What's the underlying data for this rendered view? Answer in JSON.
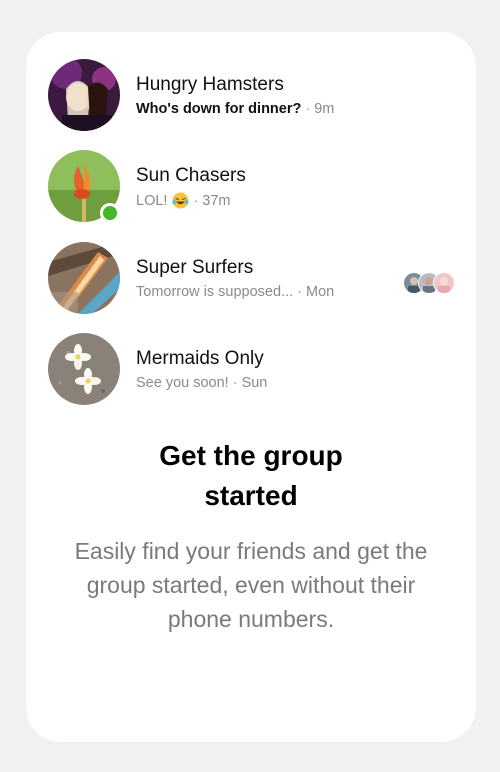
{
  "conversations": [
    {
      "name": "Hungry Hamsters",
      "message": "Who's down for dinner?",
      "separator": "·",
      "time": "9m",
      "unread": true
    },
    {
      "name": "Sun Chasers",
      "message": "LOL!",
      "emoji": "laughing-tears-emoji",
      "separator": "·",
      "time": "37m",
      "online": true
    },
    {
      "name": "Super Surfers",
      "message": "Tomorrow is supposed...",
      "separator": "·",
      "time": "Mon",
      "seen_by_count": 3
    },
    {
      "name": "Mermaids Only",
      "message": "See you soon!",
      "separator": "·",
      "time": "Sun"
    }
  ],
  "promo": {
    "title_line1": "Get the group",
    "title_line2": "started",
    "body": "Easily find your friends and get the group started, even without their phone numbers."
  },
  "colors": {
    "online": "#42b72a",
    "title": "#000000",
    "body": "#7a7a7a",
    "snippet": "#8a8a8a"
  }
}
